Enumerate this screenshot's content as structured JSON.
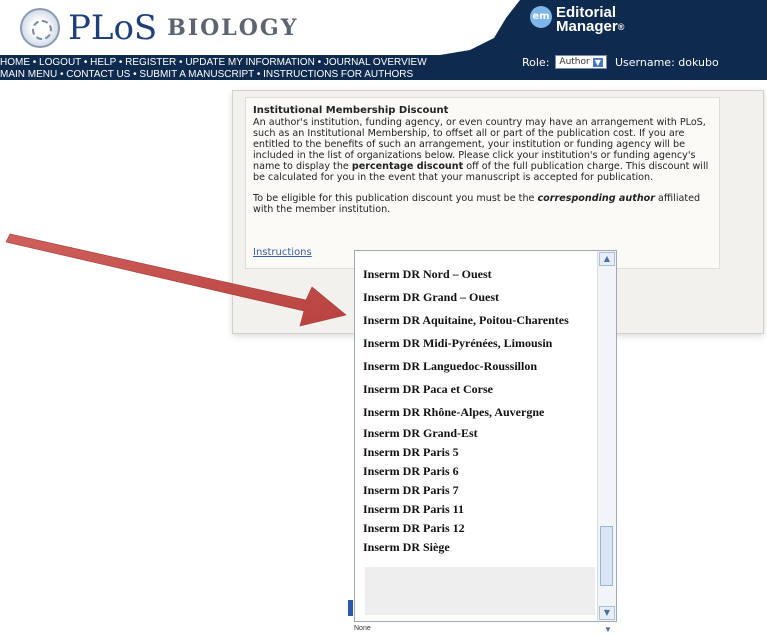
{
  "header": {
    "logo_plos": "PLoS",
    "logo_biology": "BIOLOGY",
    "em_badge": "em",
    "em_line1": "Editorial",
    "em_line2": "Manager",
    "em_reg": "®",
    "nav_line1": "HOME • LOGOUT • HELP • REGISTER • UPDATE MY INFORMATION • JOURNAL OVERVIEW",
    "nav_line2": "MAIN MENU • CONTACT US • SUBMIT A MANUSCRIPT • INSTRUCTIONS FOR AUTHORS",
    "role_label": "Role:",
    "role_value": "Author",
    "username_label": "Username: dokubo"
  },
  "panel": {
    "title": "Institutional Membership Discount",
    "p1_a": "An author's institution, funding agency, or even country may have an arrangement with PLoS, such as an Institutional Membership, to offset all or part of the publication cost. If you are entitled to the benefits of such an arrangement, your institution or funding agency will be included in the list of organizations below. Please click your institution's or funding agency's name to display the ",
    "p1_bold": "percentage discount",
    "p1_b": " off of the full publication charge. This discount will be calculated for you in the event that your manuscript is accepted for publication.",
    "p2_a": "To be eligible for this publication discount you must be the ",
    "p2_bold": "corresponding author",
    "p2_b": " affiliated with the member institution.",
    "instructions_link": "Instructions"
  },
  "dropdown": {
    "items": [
      "Inserm DR Nord – Ouest",
      "Inserm DR Grand – Ouest",
      "Inserm DR Aquitaine, Poitou-Charentes",
      "Inserm DR Midi-Pyrénées, Limousin",
      "Inserm DR Languedoc-Roussillon",
      "Inserm DR Paca et Corse",
      "Inserm DR Rhône-Alpes, Auvergne",
      "Inserm DR Grand-Est",
      "Inserm DR Paris 5",
      "Inserm DR Paris 6",
      "Inserm DR Paris 7",
      "Inserm DR Paris 11",
      "Inserm DR Paris 12",
      "Inserm DR Siège"
    ],
    "selected_value": "None"
  },
  "colors": {
    "navy": "#0e2a4e",
    "arrow": "#c0504d"
  }
}
